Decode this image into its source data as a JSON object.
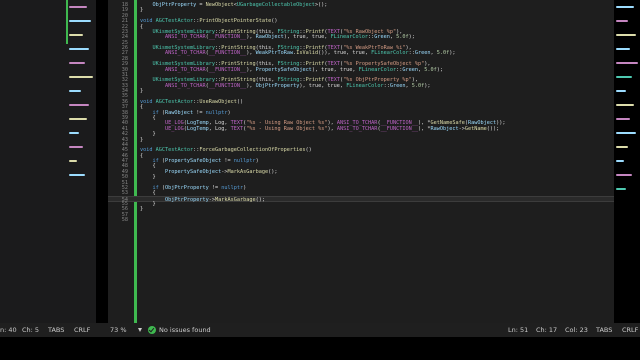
{
  "editor": {
    "lines": [
      {
        "n": "18",
        "tokens": [
          {
            "c": "    "
          },
          {
            "c": "ObjPtrProperty",
            "k": "var"
          },
          {
            "c": " = "
          },
          {
            "c": "NewObject",
            "k": "fn"
          },
          {
            "c": "<"
          },
          {
            "c": "UGarbageCollectableObject",
            "k": "ty"
          },
          {
            "c": ">();"
          }
        ]
      },
      {
        "n": "19",
        "tokens": [
          {
            "c": "}"
          }
        ]
      },
      {
        "n": "20",
        "tokens": []
      },
      {
        "n": "21",
        "tokens": [
          {
            "c": "void ",
            "k": "kw"
          },
          {
            "c": "AGCTestActor",
            "k": "ty"
          },
          {
            "c": "::"
          },
          {
            "c": "PrintObjectPointerState",
            "k": "fn"
          },
          {
            "c": "()"
          }
        ]
      },
      {
        "n": "22",
        "tokens": [
          {
            "c": "{"
          }
        ]
      },
      {
        "n": "23",
        "tokens": [
          {
            "c": "    "
          },
          {
            "c": "UKismetSystemLibrary",
            "k": "ty"
          },
          {
            "c": "::"
          },
          {
            "c": "PrintString",
            "k": "fn"
          },
          {
            "c": "(this, "
          },
          {
            "c": "FString",
            "k": "ty"
          },
          {
            "c": "::"
          },
          {
            "c": "Printf",
            "k": "fn"
          },
          {
            "c": "("
          },
          {
            "c": "TEXT",
            "k": "mac"
          },
          {
            "c": "("
          },
          {
            "c": "\"%s RawObject %p\"",
            "k": "str"
          },
          {
            "c": "),"
          }
        ]
      },
      {
        "n": "24",
        "tokens": [
          {
            "c": "        "
          },
          {
            "c": "ANSI_TO_TCHAR",
            "k": "mac"
          },
          {
            "c": "("
          },
          {
            "c": "__FUNCTION__",
            "k": "mac"
          },
          {
            "c": "), "
          },
          {
            "c": "RawObject",
            "k": "var"
          },
          {
            "c": "), true, true, "
          },
          {
            "c": "FLinearColor",
            "k": "ty"
          },
          {
            "c": "::"
          },
          {
            "c": "Green",
            "k": "var"
          },
          {
            "c": ", "
          },
          {
            "c": "5.0f",
            "k": "num"
          },
          {
            "c": ");"
          }
        ]
      },
      {
        "n": "25",
        "tokens": []
      },
      {
        "n": "26",
        "tokens": [
          {
            "c": "    "
          },
          {
            "c": "UKismetSystemLibrary",
            "k": "ty"
          },
          {
            "c": "::"
          },
          {
            "c": "PrintString",
            "k": "fn"
          },
          {
            "c": "(this, "
          },
          {
            "c": "FString",
            "k": "ty"
          },
          {
            "c": "::"
          },
          {
            "c": "Printf",
            "k": "fn"
          },
          {
            "c": "("
          },
          {
            "c": "TEXT",
            "k": "mac"
          },
          {
            "c": "("
          },
          {
            "c": "\"%s WeakPtrToRaw %i\"",
            "k": "str"
          },
          {
            "c": "),"
          }
        ]
      },
      {
        "n": "27",
        "tokens": [
          {
            "c": "        "
          },
          {
            "c": "ANSI_TO_TCHAR",
            "k": "mac"
          },
          {
            "c": "("
          },
          {
            "c": "__FUNCTION__",
            "k": "mac"
          },
          {
            "c": "), "
          },
          {
            "c": "WeakPtrToRaw",
            "k": "var"
          },
          {
            "c": "."
          },
          {
            "c": "IsValid",
            "k": "fn"
          },
          {
            "c": "()), true, true, "
          },
          {
            "c": "FLinearColor",
            "k": "ty"
          },
          {
            "c": "::"
          },
          {
            "c": "Green",
            "k": "var"
          },
          {
            "c": ", "
          },
          {
            "c": "5.0f",
            "k": "num"
          },
          {
            "c": ");"
          }
        ]
      },
      {
        "n": "28",
        "tokens": []
      },
      {
        "n": "29",
        "tokens": [
          {
            "c": "    "
          },
          {
            "c": "UKismetSystemLibrary",
            "k": "ty"
          },
          {
            "c": "::"
          },
          {
            "c": "PrintString",
            "k": "fn"
          },
          {
            "c": "(this, "
          },
          {
            "c": "FString",
            "k": "ty"
          },
          {
            "c": "::"
          },
          {
            "c": "Printf",
            "k": "fn"
          },
          {
            "c": "("
          },
          {
            "c": "TEXT",
            "k": "mac"
          },
          {
            "c": "("
          },
          {
            "c": "\"%s PropertySafeObject %p\"",
            "k": "str"
          },
          {
            "c": "),"
          }
        ]
      },
      {
        "n": "30",
        "tokens": [
          {
            "c": "        "
          },
          {
            "c": "ANSI_TO_TCHAR",
            "k": "mac"
          },
          {
            "c": "("
          },
          {
            "c": "__FUNCTION__",
            "k": "mac"
          },
          {
            "c": "), "
          },
          {
            "c": "PropertySafeObject",
            "k": "var"
          },
          {
            "c": "), true, true, "
          },
          {
            "c": "FLinearColor",
            "k": "ty"
          },
          {
            "c": "::"
          },
          {
            "c": "Green",
            "k": "var"
          },
          {
            "c": ", "
          },
          {
            "c": "5.0f",
            "k": "num"
          },
          {
            "c": ");"
          }
        ]
      },
      {
        "n": "31",
        "tokens": []
      },
      {
        "n": "32",
        "tokens": [
          {
            "c": "    "
          },
          {
            "c": "UKismetSystemLibrary",
            "k": "ty"
          },
          {
            "c": "::"
          },
          {
            "c": "PrintString",
            "k": "fn"
          },
          {
            "c": "(this, "
          },
          {
            "c": "FString",
            "k": "ty"
          },
          {
            "c": "::"
          },
          {
            "c": "Printf",
            "k": "fn"
          },
          {
            "c": "("
          },
          {
            "c": "TEXT",
            "k": "mac"
          },
          {
            "c": "("
          },
          {
            "c": "\"%s ObjPtrProperty %p\"",
            "k": "str"
          },
          {
            "c": "),"
          }
        ]
      },
      {
        "n": "33",
        "tokens": [
          {
            "c": "        "
          },
          {
            "c": "ANSI_TO_TCHAR",
            "k": "mac"
          },
          {
            "c": "("
          },
          {
            "c": "__FUNCTION__",
            "k": "mac"
          },
          {
            "c": "), "
          },
          {
            "c": "ObjPtrProperty",
            "k": "var"
          },
          {
            "c": "), true, true, "
          },
          {
            "c": "FLinearColor",
            "k": "ty"
          },
          {
            "c": "::"
          },
          {
            "c": "Green",
            "k": "var"
          },
          {
            "c": ", "
          },
          {
            "c": "5.0f",
            "k": "num"
          },
          {
            "c": ");"
          }
        ]
      },
      {
        "n": "34",
        "tokens": [
          {
            "c": "}"
          }
        ]
      },
      {
        "n": "35",
        "tokens": []
      },
      {
        "n": "36",
        "tokens": [
          {
            "c": "void ",
            "k": "kw"
          },
          {
            "c": "AGCTestActor",
            "k": "ty"
          },
          {
            "c": "::"
          },
          {
            "c": "UseRawObject",
            "k": "fn"
          },
          {
            "c": "()"
          }
        ]
      },
      {
        "n": "37",
        "tokens": [
          {
            "c": "{"
          }
        ]
      },
      {
        "n": "38",
        "tokens": [
          {
            "c": "    "
          },
          {
            "c": "if ",
            "k": "kw"
          },
          {
            "c": "("
          },
          {
            "c": "RawObject",
            "k": "var"
          },
          {
            "c": " != "
          },
          {
            "c": "nullptr",
            "k": "kw"
          },
          {
            "c": ")"
          }
        ]
      },
      {
        "n": "39",
        "tokens": [
          {
            "c": "    {"
          }
        ]
      },
      {
        "n": "40",
        "tokens": [
          {
            "c": "        "
          },
          {
            "c": "UE_LOG",
            "k": "mac"
          },
          {
            "c": "("
          },
          {
            "c": "LogTemp",
            "k": "var"
          },
          {
            "c": ", Log, "
          },
          {
            "c": "TEXT",
            "k": "mac"
          },
          {
            "c": "("
          },
          {
            "c": "\"%s - Using Raw Object %s\"",
            "k": "str"
          },
          {
            "c": "), "
          },
          {
            "c": "ANSI_TO_TCHAR",
            "k": "mac"
          },
          {
            "c": "("
          },
          {
            "c": "__FUNCTION__",
            "k": "mac"
          },
          {
            "c": "), *"
          },
          {
            "c": "GetNameSafe",
            "k": "fn"
          },
          {
            "c": "("
          },
          {
            "c": "RawObject",
            "k": "var"
          },
          {
            "c": "));"
          }
        ]
      },
      {
        "n": "41",
        "tokens": [
          {
            "c": "        "
          },
          {
            "c": "UE_LOG",
            "k": "mac"
          },
          {
            "c": "("
          },
          {
            "c": "LogTemp",
            "k": "var"
          },
          {
            "c": ", Log, "
          },
          {
            "c": "TEXT",
            "k": "mac"
          },
          {
            "c": "("
          },
          {
            "c": "\"%s - Using Raw Object %s\"",
            "k": "str"
          },
          {
            "c": "), "
          },
          {
            "c": "ANSI_TO_TCHAR",
            "k": "mac"
          },
          {
            "c": "("
          },
          {
            "c": "__FUNCTION__",
            "k": "mac"
          },
          {
            "c": "), *"
          },
          {
            "c": "RawObject",
            "k": "var"
          },
          {
            "c": "->"
          },
          {
            "c": "GetName",
            "k": "fn"
          },
          {
            "c": "());"
          }
        ]
      },
      {
        "n": "42",
        "tokens": [
          {
            "c": "    }"
          }
        ]
      },
      {
        "n": "43",
        "tokens": [
          {
            "c": "}"
          }
        ]
      },
      {
        "n": "44",
        "tokens": []
      },
      {
        "n": "45",
        "tokens": [
          {
            "c": "void ",
            "k": "kw"
          },
          {
            "c": "AGCTestActor",
            "k": "ty"
          },
          {
            "c": "::"
          },
          {
            "c": "ForceGarbageCollectionOfProperties",
            "k": "fn"
          },
          {
            "c": "()"
          }
        ]
      },
      {
        "n": "46",
        "tokens": [
          {
            "c": "{"
          }
        ]
      },
      {
        "n": "47",
        "tokens": [
          {
            "c": "    "
          },
          {
            "c": "if ",
            "k": "kw"
          },
          {
            "c": "("
          },
          {
            "c": "PropertySafeObject",
            "k": "var"
          },
          {
            "c": " != "
          },
          {
            "c": "nullptr",
            "k": "kw"
          },
          {
            "c": ")"
          }
        ]
      },
      {
        "n": "48",
        "tokens": [
          {
            "c": "    {"
          }
        ]
      },
      {
        "n": "49",
        "tokens": [
          {
            "c": "        "
          },
          {
            "c": "PropertySafeObject",
            "k": "var"
          },
          {
            "c": "->"
          },
          {
            "c": "MarkAsGarbage",
            "k": "fn"
          },
          {
            "c": "();"
          }
        ]
      },
      {
        "n": "50",
        "tokens": [
          {
            "c": "    }"
          }
        ]
      },
      {
        "n": "51",
        "tokens": []
      },
      {
        "n": "52",
        "tokens": [
          {
            "c": "    "
          },
          {
            "c": "if ",
            "k": "kw"
          },
          {
            "c": "("
          },
          {
            "c": "ObjPtrProperty",
            "k": "var"
          },
          {
            "c": " != "
          },
          {
            "c": "nullptr",
            "k": "kw"
          },
          {
            "c": ")"
          }
        ]
      },
      {
        "n": "53",
        "tokens": [
          {
            "c": "    {"
          }
        ]
      },
      {
        "n": "54",
        "tokens": [
          {
            "c": "        "
          },
          {
            "c": "ObjPtrProperty",
            "k": "var"
          },
          {
            "c": "->"
          },
          {
            "c": "MarkAsGarbage",
            "k": "fn"
          },
          {
            "c": "();"
          }
        ],
        "current": true
      },
      {
        "n": "55",
        "tokens": [
          {
            "c": "    }"
          }
        ]
      },
      {
        "n": "56",
        "tokens": [
          {
            "c": "}"
          }
        ]
      },
      {
        "n": "57",
        "tokens": []
      },
      {
        "n": "58",
        "tokens": []
      }
    ]
  },
  "statusbar": {
    "left_ln": "n: 40",
    "left_ch": "Ch: 5",
    "left_tabs": "TABS",
    "left_crlf": "CRLF",
    "zoom": "73 %",
    "issues": "No issues found",
    "ln": "Ln: 51",
    "ch": "Ch: 17",
    "col": "Col: 23",
    "tabs": "TABS",
    "crlf": "CRLF"
  },
  "colors": {
    "editor_bg": "#1e1e1e",
    "margin_green": "#3fb950",
    "keyword": "#569cd6",
    "type": "#4ec9b0",
    "function": "#dcdcaa",
    "string": "#d69d85",
    "macro": "#bd63c5",
    "variable": "#9cdcfe",
    "number": "#b5cea8"
  },
  "minimap": {
    "left_lines": [
      [
        "#c586c0",
        18
      ],
      [
        "#9cdcfe",
        22
      ],
      [
        "#dcdcaa",
        14
      ],
      [
        "#9cdcfe",
        20
      ],
      [
        "#c586c0",
        16
      ],
      [
        "#dcdcaa",
        24
      ],
      [
        "#9cdcfe",
        12
      ],
      [
        "#c586c0",
        20
      ],
      [
        "#dcdcaa",
        18
      ],
      [
        "#9cdcfe",
        10
      ],
      [
        "#c586c0",
        14
      ],
      [
        "#dcdcaa",
        8
      ],
      [
        "#9cdcfe",
        16
      ]
    ],
    "right_lines": [
      [
        "#9cdcfe",
        18
      ],
      [
        "#c586c0",
        12
      ],
      [
        "#dcdcaa",
        20
      ],
      [
        "#9cdcfe",
        14
      ],
      [
        "#c586c0",
        22
      ],
      [
        "#4ec9b0",
        16
      ],
      [
        "#9cdcfe",
        10
      ],
      [
        "#dcdcaa",
        18
      ],
      [
        "#c586c0",
        14
      ],
      [
        "#9cdcfe",
        20
      ],
      [
        "#dcdcaa",
        12
      ],
      [
        "#9cdcfe",
        8
      ],
      [
        "#c586c0",
        16
      ],
      [
        "#4ec9b0",
        10
      ]
    ]
  }
}
